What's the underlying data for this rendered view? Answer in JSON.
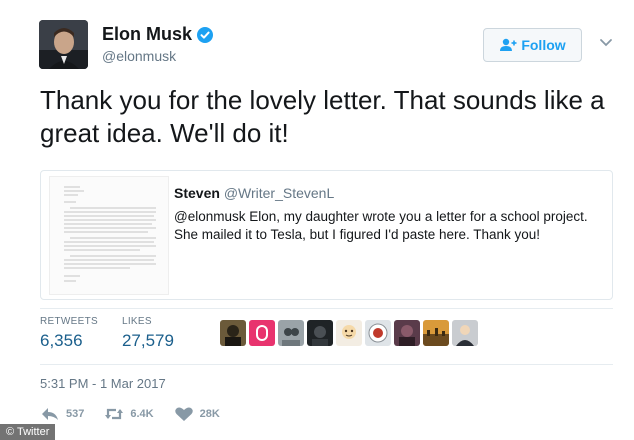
{
  "author": {
    "display_name": "Elon Musk",
    "handle": "@elonmusk",
    "verified": true,
    "avatar_icon": "profile-photo"
  },
  "follow_button": {
    "label": "Follow",
    "icon": "add-user-icon"
  },
  "menu_icon": "chevron-down-icon",
  "tweet": {
    "text": "Thank you for the lovely letter. That sounds like a great idea. We'll do it!"
  },
  "quoted_tweet": {
    "author_name": "Steven",
    "author_handle": "@Writer_StevenL",
    "text": "@elonmusk Elon, my daughter wrote you a letter for a school project. She mailed it to Tesla, but I figured I'd paste here. Thank you!",
    "thumbnail_icon": "letter-image"
  },
  "stats": {
    "retweets_label": "RETWEETS",
    "retweets_value": "6,356",
    "likes_label": "LIKES",
    "likes_value": "27,579",
    "likers_count_shown": 9
  },
  "timestamp": "5:31 PM - 1 Mar 2017",
  "actions": {
    "reply_count": "537",
    "retweet_count": "6.4K",
    "like_count": "28K"
  },
  "credit": "© Twitter",
  "colors": {
    "accent": "#1da1f2",
    "text": "#14171a",
    "muted": "#657786",
    "stat_value": "#1b5f8c",
    "action_icon": "#8899a6"
  }
}
